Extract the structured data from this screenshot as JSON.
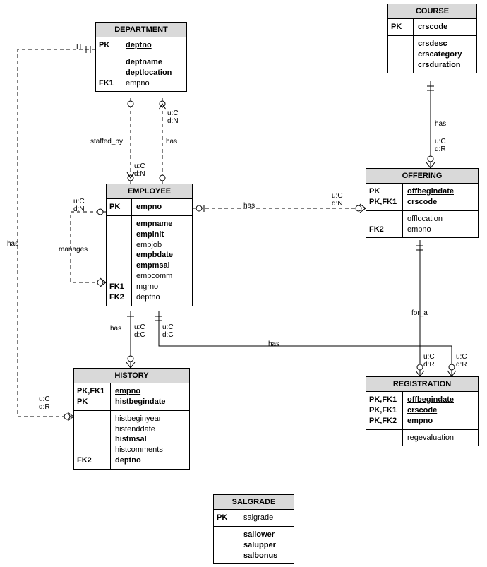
{
  "entities": {
    "department": {
      "title": "DEPARTMENT",
      "keys_row1": "PK",
      "pk": "deptno",
      "keys_row2": "FK1",
      "attrs": [
        "deptname",
        "deptlocation"
      ],
      "fk_attr": "empno"
    },
    "course": {
      "title": "COURSE",
      "keys_row1": "PK",
      "pk": "crscode",
      "attrs": [
        "crsdesc",
        "crscategory",
        "crsduration"
      ]
    },
    "employee": {
      "title": "EMPLOYEE",
      "keys_row1": "PK",
      "pk": "empno",
      "keys_row2": "FK1\nFK2",
      "attrs_bold": [
        "empname",
        "empinit"
      ],
      "attrs_plain1": [
        "empjob"
      ],
      "attrs_bold2": [
        "empbdate",
        "empmsal"
      ],
      "attrs_plain2": [
        "empcomm",
        "mgrno",
        "deptno"
      ]
    },
    "offering": {
      "title": "OFFERING",
      "keys_row1": "PK\nPK,FK1",
      "pk1": "offbegindate",
      "pk2": "crscode",
      "keys_row2": "FK2",
      "attrs": [
        "offlocation",
        "empno"
      ]
    },
    "history": {
      "title": "HISTORY",
      "keys_row1": "PK,FK1\nPK",
      "pk1": "empno",
      "pk2": "histbegindate",
      "keys_row2": "FK2",
      "attrs_plain": [
        "histbeginyear",
        "histenddate"
      ],
      "attrs_bold": [
        "histmsal"
      ],
      "attrs_plain2": [
        "histcomments"
      ],
      "attrs_bold2": [
        "deptno"
      ]
    },
    "registration": {
      "title": "REGISTRATION",
      "keys_row1": "PK,FK1\nPK,FK1\nPK,FK2",
      "pk1": "offbegindate",
      "pk2": "crscode",
      "pk3": "empno",
      "attr": "regevaluation"
    },
    "salgrade": {
      "title": "SALGRADE",
      "keys_row1": "PK",
      "pk": "salgrade",
      "attrs": [
        "sallower",
        "salupper",
        "salbonus"
      ]
    }
  },
  "relationships": {
    "staffed_by": "staffed_by",
    "has_dept_emp": "has",
    "has_course_off": "has",
    "has_emp_off": "has",
    "has_emp_hist": "has",
    "has_emp_reg": "has",
    "for_a": "for_a",
    "manages": "manages",
    "has_dept_hist": "has",
    "H": "H"
  },
  "cardinality": {
    "uC": "u:C",
    "dN": "d:N",
    "dR": "d:R",
    "dC": "d:C"
  }
}
